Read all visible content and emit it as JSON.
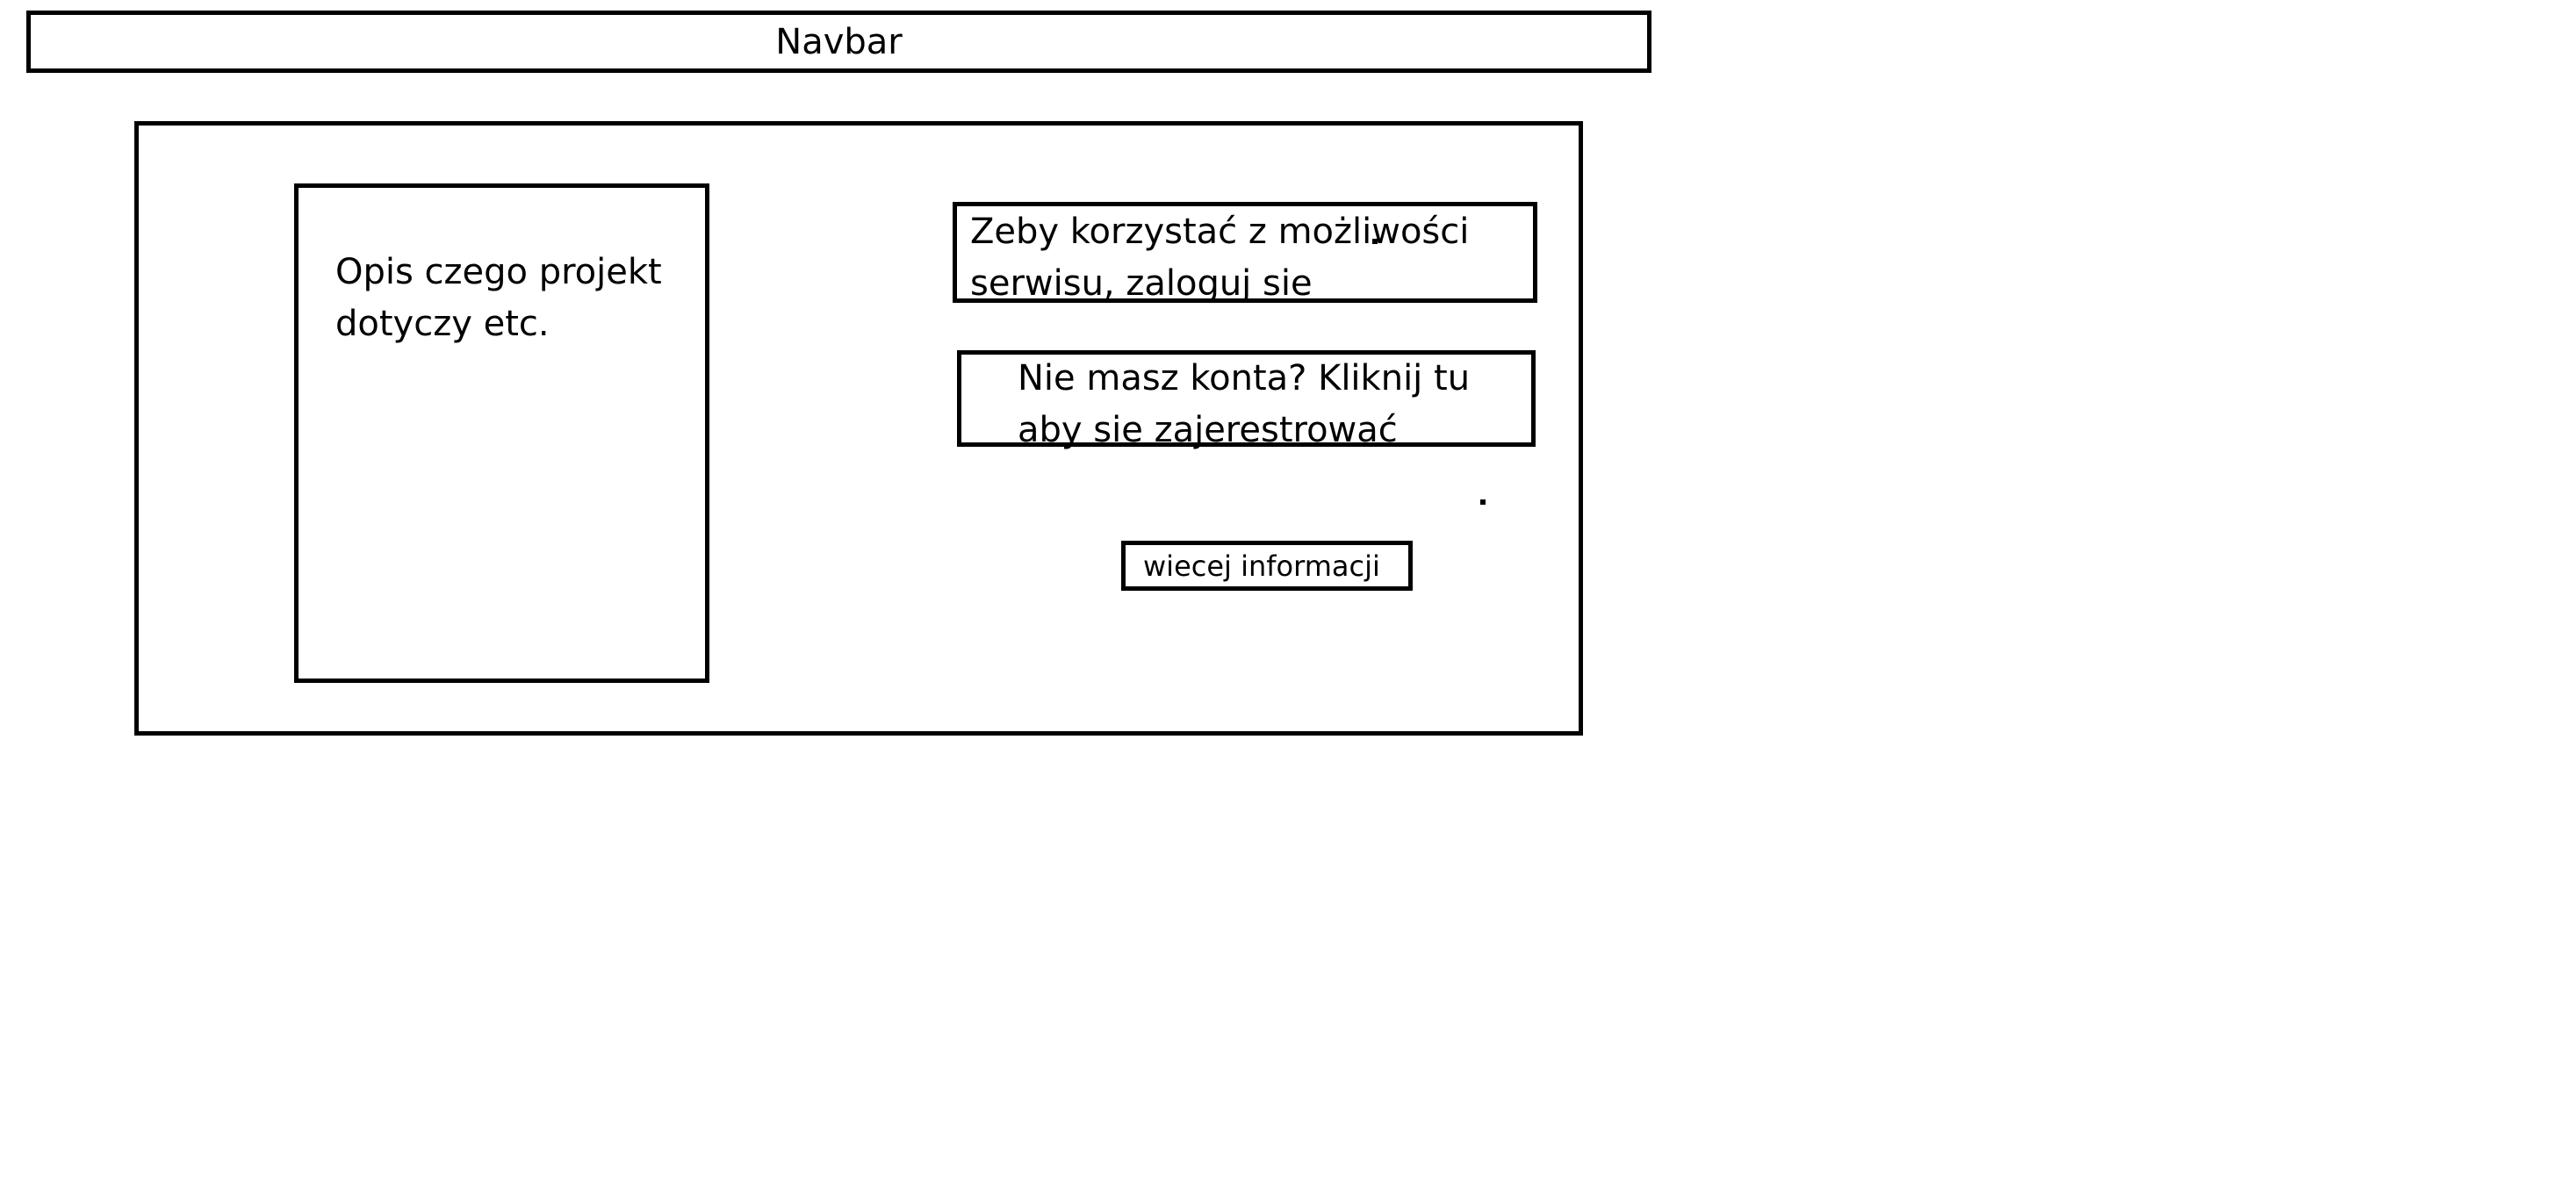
{
  "navbar": {
    "label": "Navbar"
  },
  "description": {
    "text": "Opis czego projekt dotyczy etc."
  },
  "login_prompt": {
    "text": "Zeby korzystać z możliwości serwisu, zaloguj sie"
  },
  "register_prompt": {
    "text": "Nie masz konta? Kliknij tu aby sie zajerestrować"
  },
  "more_info": {
    "label": "wiecej informacji"
  }
}
